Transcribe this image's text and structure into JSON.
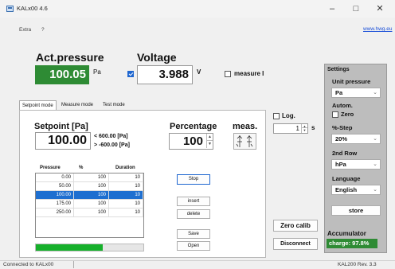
{
  "window": {
    "title": "KALx00 4.6",
    "min": "–",
    "max": "□",
    "close": "✕"
  },
  "menu": {
    "items": [
      "Extra",
      "?"
    ],
    "link": "www.hwg.eu"
  },
  "header": {
    "act_pressure_label": "Act.pressure",
    "act_pressure_value": "100.05",
    "act_pressure_unit": "Pa",
    "voltage_label": "Voltage",
    "voltage_checked": true,
    "voltage_value": "3.988",
    "voltage_unit": "V",
    "measure_i_label": "measure I",
    "measure_i_checked": false
  },
  "tabs": [
    {
      "label": "Setpoint mode",
      "active": true
    },
    {
      "label": "Measure mode",
      "active": false
    },
    {
      "label": "Test mode",
      "active": false
    }
  ],
  "setpoint": {
    "label": "Setpoint [Pa]",
    "value": "100.00",
    "limit_max": "< 600.00 [Pa]",
    "limit_min": "> -600.00 [Pa]",
    "percentage_label": "Percentage",
    "percentage_value": "100",
    "meas_label": "meas."
  },
  "table": {
    "headers": [
      "Pressure",
      "%",
      "Duration"
    ],
    "rows": [
      [
        "0.00",
        "100",
        "10"
      ],
      [
        "50.00",
        "100",
        "10"
      ],
      [
        "100.00",
        "100",
        "10"
      ],
      [
        "175.00",
        "100",
        "10"
      ],
      [
        "250.00",
        "100",
        "10"
      ]
    ],
    "selected_row": 2
  },
  "progress": {
    "fraction": 0.62
  },
  "buttons": {
    "stop": "Stop",
    "insert": "insert",
    "delete": "delete",
    "save": "Save",
    "open": "Open",
    "zero_calib": "Zero calib",
    "disconnect": "Disconnect"
  },
  "log": {
    "label": "Log.",
    "checked": false,
    "interval_value": "1",
    "interval_unit": "s"
  },
  "settings": {
    "title": "Settings",
    "unit_pressure_label": "Unit pressure",
    "unit_pressure_value": "Pa",
    "autom_label": "Autom.",
    "zero_label": "Zero",
    "zero_checked": false,
    "step_label": "%-Step",
    "step_value": "20%",
    "second_row_label": "2nd Row",
    "second_row_value": "hPa",
    "language_label": "Language",
    "language_value": "English",
    "store_label": "store",
    "accumulator_label": "Accumulator",
    "charge_value": "charge: 97.8%"
  },
  "status": {
    "left": "Connected to KALx00",
    "right": "KAL200 Rev. 3.3"
  },
  "colors": {
    "green": "#2e8b34",
    "selection": "#1e6fd0",
    "progress": "#16b02b",
    "panel": "#bdbdbd"
  },
  "icons": [
    "app-icon",
    "chevron-down-icon",
    "meas-toggle-icon"
  ]
}
